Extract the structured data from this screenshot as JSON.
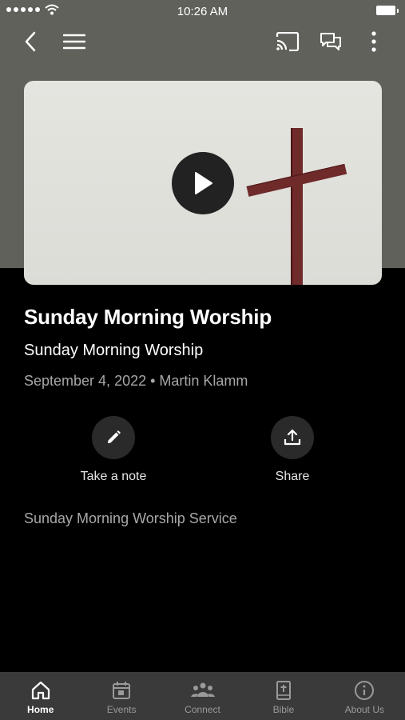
{
  "status_bar": {
    "time": "10:26 AM"
  },
  "video": {
    "title": "Sunday Morning Worship"
  },
  "sermon": {
    "title": "Sunday Morning Worship",
    "subtitle": "Sunday Morning Worship",
    "meta": "September 4, 2022 • Martin Klamm",
    "description": "Sunday Morning Worship Service"
  },
  "actions": {
    "note_label": "Take a note",
    "share_label": "Share"
  },
  "tabs": [
    {
      "label": "Home",
      "icon": "home-icon",
      "active": true
    },
    {
      "label": "Events",
      "icon": "calendar-icon",
      "active": false
    },
    {
      "label": "Connect",
      "icon": "group-icon",
      "active": false
    },
    {
      "label": "Bible",
      "icon": "bible-icon",
      "active": false
    },
    {
      "label": "About Us",
      "icon": "info-icon",
      "active": false
    }
  ],
  "colors": {
    "header_bg": "#61615c",
    "tabbar_bg": "#3a3a3a",
    "cross": "#6f2a2a"
  }
}
